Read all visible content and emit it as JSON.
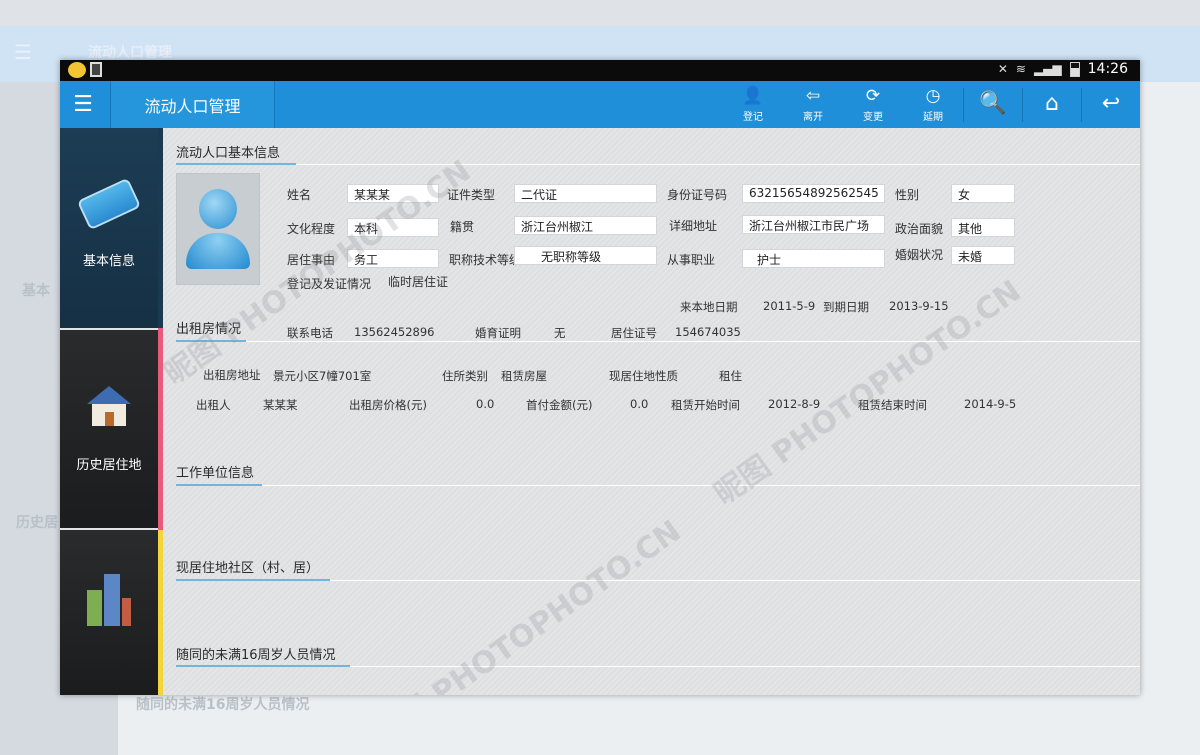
{
  "background": {
    "app_title": "流动人口管理",
    "side_labels": [
      "基本",
      "历史居"
    ],
    "footer_text": "随同的未满16周岁人员情况"
  },
  "status_bar": {
    "time": "14:26"
  },
  "app_bar": {
    "title": "流动人口管理",
    "actions": [
      {
        "icon": "register-icon",
        "glyph": "👤",
        "label": "登记"
      },
      {
        "icon": "leave-icon",
        "glyph": "⇦",
        "label": "离开"
      },
      {
        "icon": "change-icon",
        "glyph": "⟳",
        "label": "变更"
      },
      {
        "icon": "extend-icon",
        "glyph": "◷",
        "label": "延期"
      }
    ],
    "search_glyph": "🔍",
    "home_glyph": "⌂",
    "back_glyph": "↩"
  },
  "sidebar": {
    "items": [
      {
        "label": "基本信息",
        "strip_color": "#e85a7e"
      },
      {
        "label": "历史居住地",
        "strip_color": "#e85a7e"
      },
      {
        "label": "",
        "strip_color": "#f3d43a"
      }
    ]
  },
  "basic_info": {
    "title": "流动人口基本信息",
    "name_label": "姓名",
    "name": "某某某",
    "id_type_label": "证件类型",
    "id_type": "二代证",
    "id_no_label": "身份证号码",
    "id_no": "63215654892562545",
    "gender_label": "性别",
    "gender": "女",
    "education_label": "文化程度",
    "education": "本科",
    "native_label": "籍贯",
    "native": "浙江台州椒江",
    "address_label": "详细地址",
    "address": "浙江台州椒江市民广场",
    "political_label": "政治面貌",
    "political": "其他",
    "reason_label": "居住事由",
    "reason": "务工",
    "title_level_label": "职称技术等级",
    "title_level": "无职称等级",
    "occupation_label": "从事职业",
    "occupation": "护士",
    "marital_label": "婚姻状况",
    "marital": "未婚",
    "cert_label": "登记及发证情况",
    "cert": "临时居住证",
    "arrive_label": "来本地日期",
    "arrive": "2011-5-9",
    "expire_label": "到期日期",
    "expire": "2013-9-15",
    "phone_label": "联系电话",
    "phone": "13562452896",
    "birth_cert_label": "婚育证明",
    "birth_cert": "无",
    "residence_no_label": "居住证号",
    "residence_no": "154674035"
  },
  "rental": {
    "title": "出租房情况",
    "address_label": "出租房地址",
    "address": "景元小区7幢701室",
    "type_label": "住所类别",
    "type": "租赁房屋",
    "nature_label": "现居住地性质",
    "nature": "租住",
    "lessor_label": "出租人",
    "lessor": "某某某",
    "price_label": "出租房价格(元)",
    "price": "0.0",
    "down_label": "首付金额(元)",
    "down": "0.0",
    "start_label": "租赁开始时间",
    "start": "2012-8-9",
    "end_label": "租赁结束时间",
    "end": "2014-9-5"
  },
  "work": {
    "title": "工作单位信息"
  },
  "community": {
    "title": "现居住地社区（村、居）"
  },
  "minors": {
    "title": "随同的未满16周岁人员情况"
  },
  "watermark": "昵图 PHOTOPHOTO.CN"
}
